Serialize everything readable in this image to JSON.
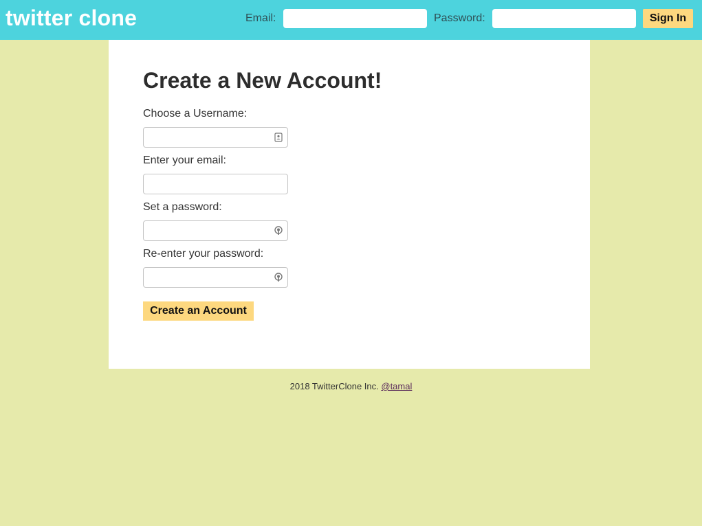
{
  "header": {
    "brand": "twitter clone",
    "email_label": "Email:",
    "email_value": "",
    "password_label": "Password:",
    "password_value": "",
    "signin_label": "Sign In"
  },
  "signup": {
    "title": "Create a New Account!",
    "username_label": "Choose a Username:",
    "email_label": "Enter your email:",
    "password_label": "Set a password:",
    "confirm_label": "Re-enter your password:",
    "submit_label": "Create an Account"
  },
  "footer": {
    "text": "2018 TwitterClone Inc.",
    "link": "@tamal"
  },
  "colors": {
    "header_bg": "#4dd3dd",
    "page_bg": "#e6eaab",
    "button_bg": "#fdd87f"
  }
}
